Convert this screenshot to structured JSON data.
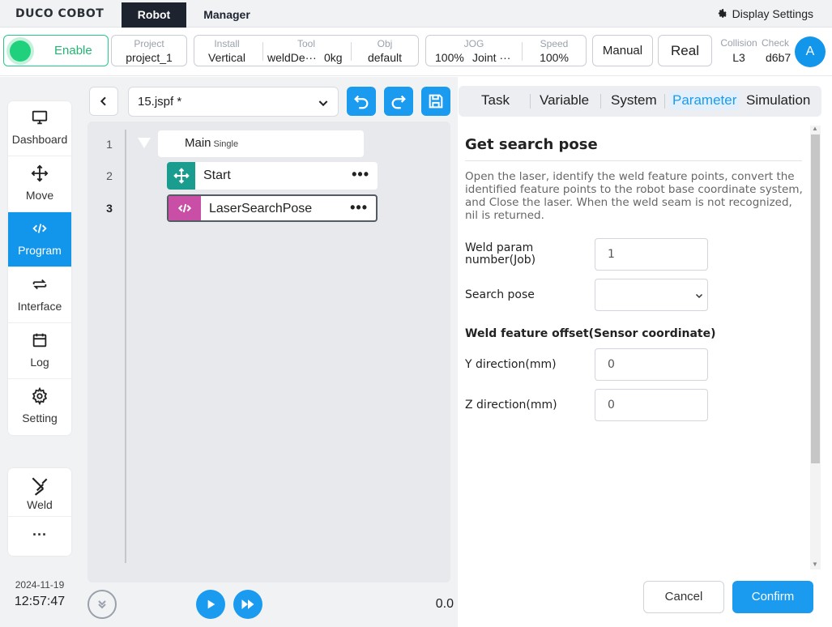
{
  "app": {
    "logo": "DUCO COBOT",
    "tabs": [
      {
        "label": "Robot"
      },
      {
        "label": "Manager"
      }
    ],
    "display_settings": "Display Settings"
  },
  "status": {
    "enable": "Enable",
    "project": {
      "label": "Project",
      "value": "project_1"
    },
    "install": {
      "label": "Install",
      "value": "Vertical"
    },
    "tool": {
      "label": "Tool",
      "value": "weldDe···",
      "weight": "0kg"
    },
    "obj": {
      "label": "Obj",
      "value": "default"
    },
    "jog": {
      "label": "JOG",
      "value": "100%",
      "mode": "Joint ···"
    },
    "speed": {
      "label": "Speed",
      "value": "100%"
    },
    "manual": "Manual",
    "real": "Real",
    "collision": {
      "label": "Collision",
      "value": "L3"
    },
    "check": {
      "label": "Check",
      "value": "d6b7"
    },
    "avatar": "A"
  },
  "nav": {
    "items": [
      {
        "label": "Dashboard",
        "icon": "monitor-icon"
      },
      {
        "label": "Move",
        "icon": "move-icon"
      },
      {
        "label": "Program",
        "icon": "code-icon"
      },
      {
        "label": "Interface",
        "icon": "swap-icon"
      },
      {
        "label": "Log",
        "icon": "calendar-icon"
      },
      {
        "label": "Setting",
        "icon": "gear-icon"
      }
    ],
    "active": "Program",
    "weld": "Weld",
    "more": "···"
  },
  "clock": {
    "date": "2024-11-19",
    "time": "12:57:47"
  },
  "editor": {
    "file": "15.jspf *",
    "line_numbers": [
      "1",
      "2",
      "3"
    ],
    "main": {
      "label": "Main",
      "tag": "Single"
    },
    "nodes": [
      {
        "label": "Start",
        "color": "#1a9d8f",
        "icon": "move-icon"
      },
      {
        "label": "LaserSearchPose",
        "color": "#c94fa6",
        "icon": "code-icon"
      }
    ],
    "node_menu": "•••",
    "speed": "0.0"
  },
  "right_tabs": [
    {
      "label": "Task"
    },
    {
      "label": "Variable"
    },
    {
      "label": "System"
    },
    {
      "label": "Parameter"
    },
    {
      "label": "Simulation"
    }
  ],
  "panel": {
    "title": "Get search pose",
    "description": "Open the laser, identify the weld feature points, convert the identified feature points to the robot base coordinate system, and Close the laser. When the weld seam is not recognized, nil is returned.",
    "fields": {
      "job_label_1": "Weld param",
      "job_label_2": "number(Job)",
      "job_value": "1",
      "search_pose_label": "Search pose",
      "search_pose_value": "",
      "offset_heading": "Weld feature offset(Sensor coordinate)",
      "y_label": "Y direction(mm)",
      "y_value": "0",
      "z_label": "Z direction(mm)",
      "z_value": "0"
    },
    "cancel": "Cancel",
    "confirm": "Confirm"
  },
  "colors": {
    "accent": "#1a9bf0",
    "enable": "#1fd07d",
    "topbar_active": "#1d2430"
  }
}
